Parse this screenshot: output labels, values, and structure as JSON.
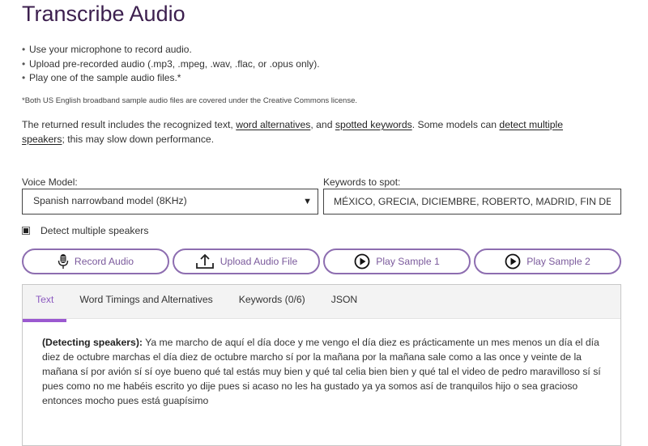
{
  "page": {
    "title": "Transcribe Audio",
    "bullets": [
      "Use your microphone to record audio.",
      "Upload pre-recorded audio (.mp3, .mpeg, .wav, .flac, or .opus only).",
      "Play one of the sample audio files.*"
    ],
    "footnote": "*Both US English broadband sample audio files are covered under the Creative Commons license.",
    "description": {
      "part1": "The returned result includes the recognized text, ",
      "link1": "word alternatives",
      "part2": ", and ",
      "link2": "spotted keywords",
      "part3": ". Some models can ",
      "link3": "detect multiple speakers",
      "part4": "; this may slow down performance."
    }
  },
  "form": {
    "voice_model_label": "Voice Model:",
    "voice_model_value": "Spanish narrowband model (8KHz)",
    "keywords_label": "Keywords to spot:",
    "keywords_value": "MÉXICO, GRECIA, DICIEMBRE, ROBERTO, MADRID, FIN DE",
    "detect_speakers_label": "Detect multiple speakers",
    "detect_speakers_checked": true
  },
  "buttons": {
    "record": "Record Audio",
    "upload": "Upload Audio File",
    "sample1": "Play Sample 1",
    "sample2": "Play Sample 2"
  },
  "results": {
    "tabs": [
      "Text",
      "Word Timings and Alternatives",
      "Keywords (0/6)",
      "JSON"
    ],
    "active_tab": "Text",
    "speaker_prefix": "(Detecting speakers):",
    "transcript": " Ya me marcho de aquí el día doce y me vengo el día diez es prácticamente un mes menos un día el día diez de octubre marchas el día diez de octubre marcho sí por la mañana por la mañana sale como a las once y veinte de la mañana sí por avión sí sí oye bueno qué tal estás muy bien y qué tal celia bien bien y qué tal el video de pedro maravilloso sí sí pues como no me habéis escrito yo dije pues si acaso no les ha gustado ya ya somos así de tranquilos hijo o sea gracioso entonces mocho pues está guapísimo"
  },
  "colors": {
    "title": "#3c1f4e",
    "accent": "#8d6db0",
    "tab_active": "#9b59d0"
  }
}
